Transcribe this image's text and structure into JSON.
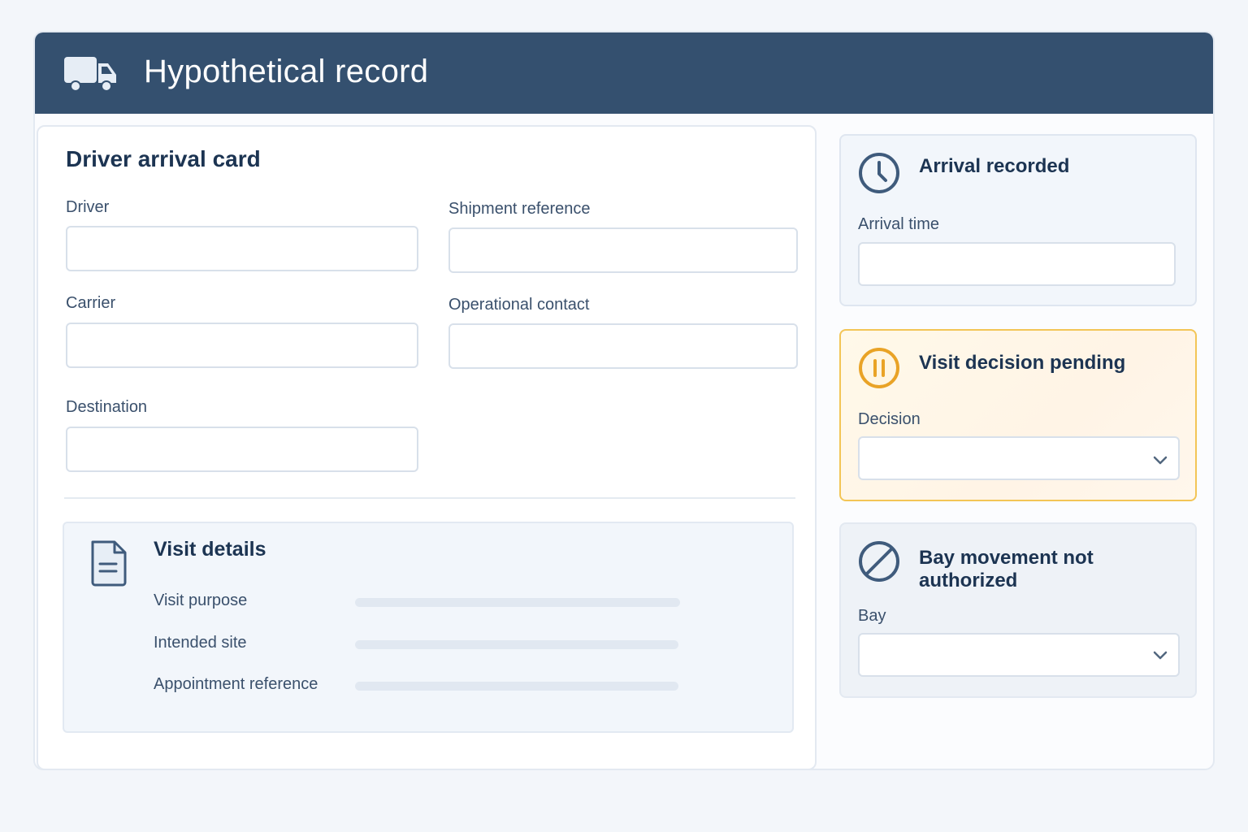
{
  "header": {
    "title": "Hypothetical record",
    "icon": "truck-icon"
  },
  "card": {
    "title": "Driver arrival card",
    "fields": {
      "driver": {
        "label": "Driver",
        "value": ""
      },
      "shipment_reference": {
        "label": "Shipment reference",
        "value": ""
      },
      "carrier": {
        "label": "Carrier",
        "value": ""
      },
      "operational_contact": {
        "label": "Operational contact",
        "value": ""
      },
      "destination": {
        "label": "Destination",
        "value": ""
      }
    },
    "visit_details": {
      "title": "Visit details",
      "icon": "document-icon",
      "rows": [
        {
          "label": "Visit purpose"
        },
        {
          "label": "Intended site"
        },
        {
          "label": "Appointment reference"
        }
      ]
    }
  },
  "panels": {
    "arrival": {
      "title": "Arrival recorded",
      "icon": "clock-icon",
      "field_label": "Arrival time",
      "value": ""
    },
    "decision": {
      "title": "Visit decision pending",
      "icon": "pause-icon",
      "field_label": "Decision",
      "value": "",
      "accent": "#e9a326"
    },
    "bay": {
      "title": "Bay movement not authorized",
      "icon": "prohibited-icon",
      "field_label": "Bay",
      "value": ""
    }
  },
  "colors": {
    "header_bg": "#34506f",
    "pending_border": "#f3c556",
    "pending_icon": "#e9a326"
  }
}
